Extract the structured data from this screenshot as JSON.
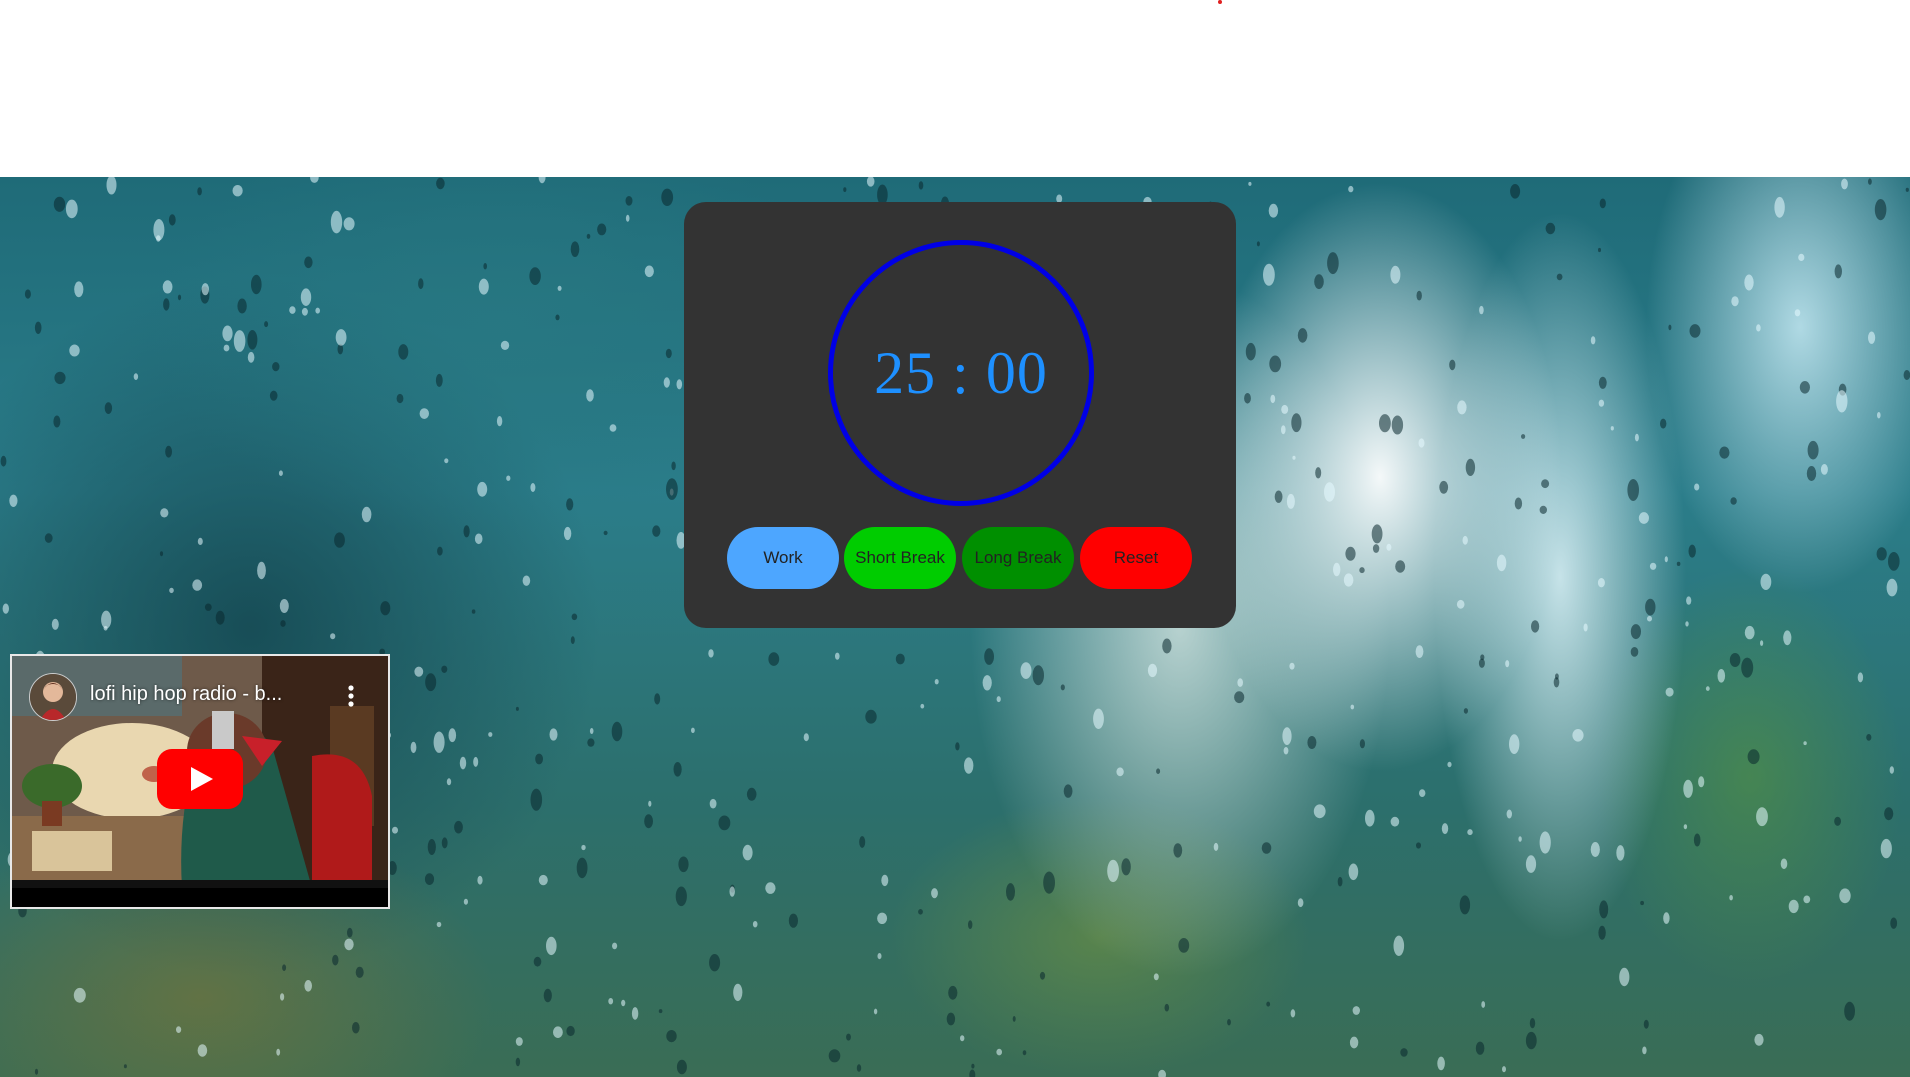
{
  "timer": {
    "display": "25 : 00"
  },
  "modes": {
    "work_label": "Work",
    "short_break_label": "Short Break",
    "long_break_label": "Long Break",
    "reset_label": "Reset"
  },
  "video": {
    "title": "lofi hip hop radio - b...",
    "menu_icon": "more-vert-icon",
    "play_icon": "youtube-play-icon"
  },
  "colors": {
    "card": "#333333",
    "ring": "#0000e6",
    "timer_text": "#1e90ff",
    "work": "#4da6ff",
    "short_break": "#00cc00",
    "long_break": "#008f00",
    "reset": "#ff0000",
    "youtube_red": "#ff0000"
  }
}
